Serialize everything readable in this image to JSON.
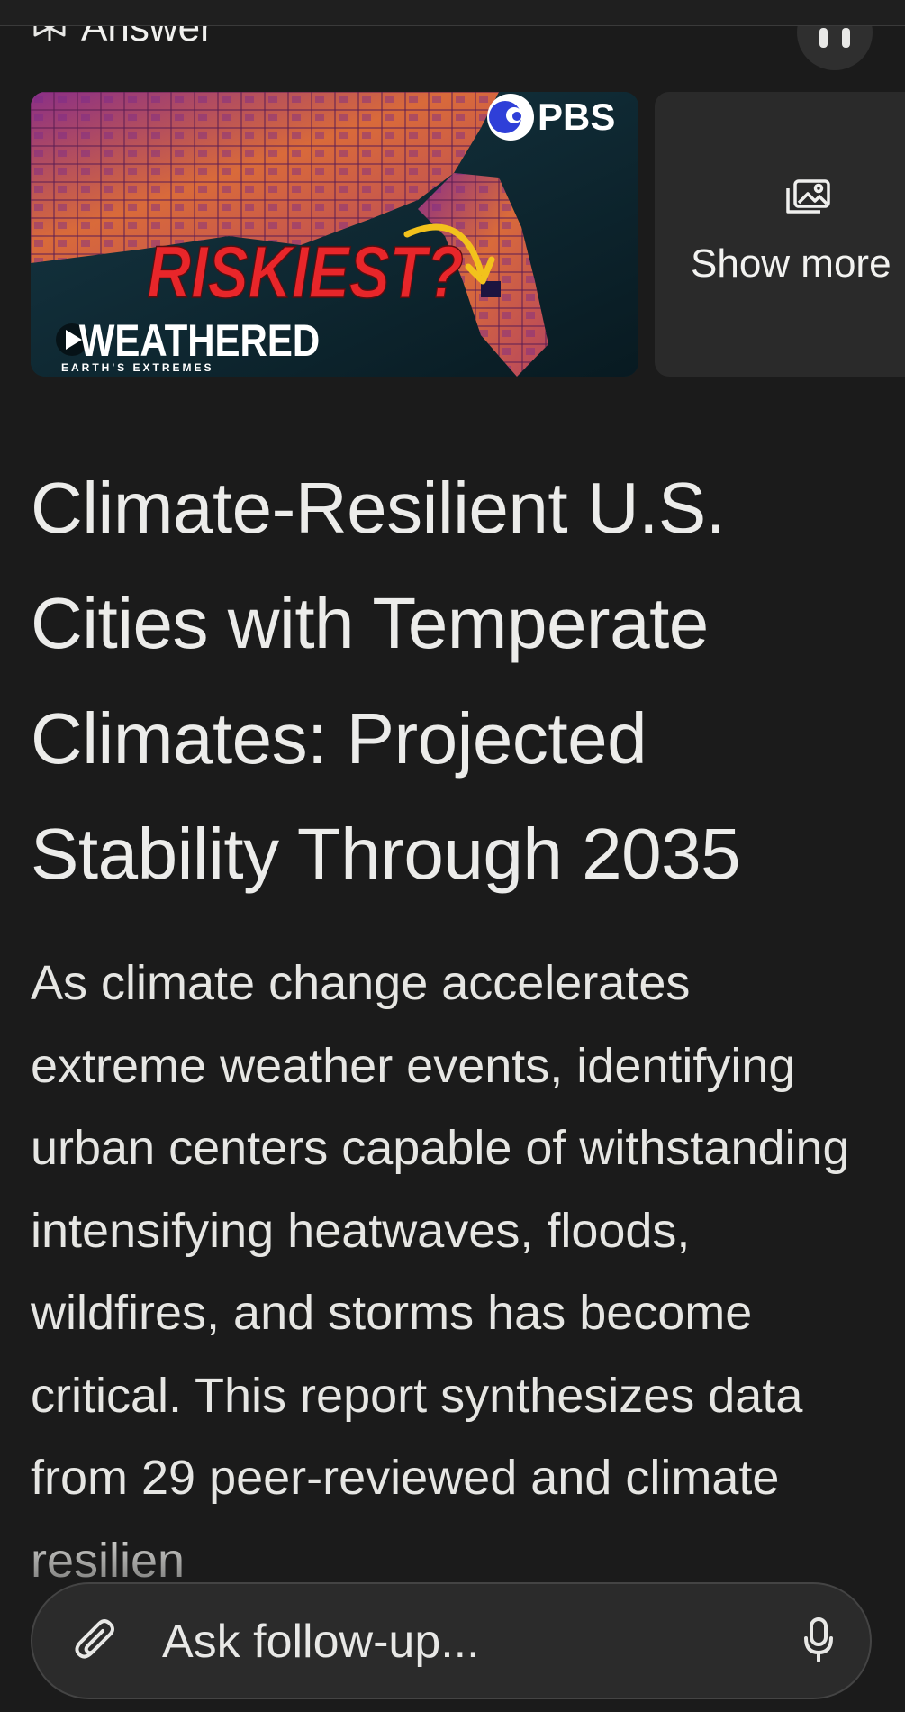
{
  "header": {
    "section_label": "Answer"
  },
  "media": {
    "video": {
      "headline": "RISKIEST?",
      "show_title": "WEATHERED",
      "show_subtitle": "EARTH'S EXTREMES",
      "channel": "PBS"
    },
    "show_more_label": "Show more"
  },
  "article": {
    "title": "Climate-Resilient U.S. Cities with Temperate Climates: Projected Stability Through 2035",
    "body": "As climate change accelerates extreme weather events, identifying urban centers capable of withstanding intensifying heatwaves, floods, wildfires, and storms has become critical. This report synthesizes data from 29 peer-reviewed and climate resilien"
  },
  "followup": {
    "placeholder": "Ask follow-up..."
  },
  "colors": {
    "background": "#1b1b1b",
    "card": "#2a2a2a",
    "accent_red": "#e8262a",
    "accent_yellow": "#f2c21c",
    "pbs_blue": "#2f3fd8"
  }
}
